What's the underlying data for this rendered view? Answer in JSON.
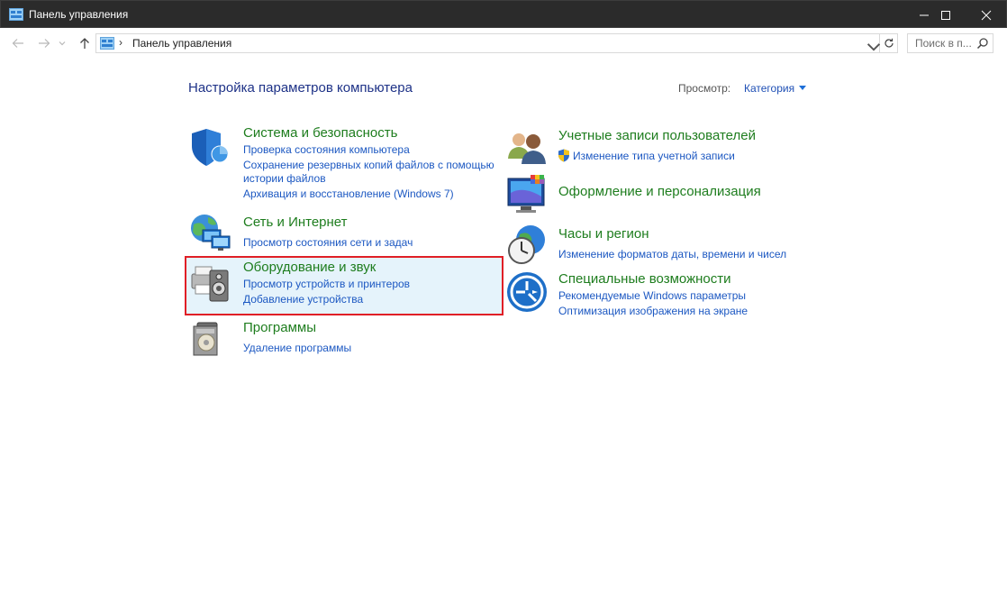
{
  "window": {
    "title": "Панель управления",
    "controls": {
      "minimize": "minimize-icon",
      "maximize": "maximize-icon",
      "close": "close-icon"
    }
  },
  "nav": {
    "breadcrumb_separator": "›",
    "address_text": "Панель управления",
    "search_placeholder": "Поиск в п..."
  },
  "content": {
    "heading": "Настройка параметров компьютера",
    "view_by_label": "Просмотр:",
    "view_by_value": "Категория"
  },
  "categories_left": [
    {
      "title": "Система и безопасность",
      "links": [
        "Проверка состояния компьютера",
        "Сохранение резервных копий файлов с помощью",
        "истории файлов",
        "Архивация и восстановление (Windows 7)"
      ]
    },
    {
      "title": "Сеть и Интернет",
      "links": [
        "Просмотр состояния сети и задач"
      ]
    },
    {
      "title": "Оборудование и звук",
      "links": [
        "Просмотр устройств и принтеров",
        "Добавление устройства"
      ]
    },
    {
      "title": "Программы",
      "links": [
        "Удаление программы"
      ]
    }
  ],
  "categories_right": [
    {
      "title": "Учетные записи пользователей",
      "links": [
        "Изменение типа учетной записи"
      ]
    },
    {
      "title": "Оформление и персонализация",
      "links": []
    },
    {
      "title": "Часы и регион",
      "links": [
        "Изменение форматов даты, времени и чисел"
      ]
    },
    {
      "title": "Специальные возможности",
      "links": [
        "Рекомендуемые Windows параметры",
        "Оптимизация изображения на экране"
      ]
    }
  ],
  "colors": {
    "title_bar": "#2b2b2b",
    "category_title": "#1e7d1e",
    "link": "#1c58c2",
    "heading": "#1e3287",
    "highlight_border": "#e01f26",
    "highlight_fill": "#e5f3fb"
  }
}
